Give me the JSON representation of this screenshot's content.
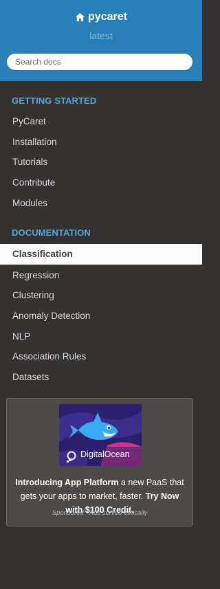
{
  "header": {
    "project_name": "pycaret",
    "version": "latest",
    "search_placeholder": "Search docs"
  },
  "sections": [
    {
      "caption": "GETTING STARTED",
      "items": [
        "PyCaret",
        "Installation",
        "Tutorials",
        "Contribute",
        "Modules"
      ]
    },
    {
      "caption": "DOCUMENTATION",
      "items": [
        "Classification",
        "Regression",
        "Clustering",
        "Anomaly Detection",
        "NLP",
        "Association Rules",
        "Datasets"
      ]
    }
  ],
  "active_item": "Classification",
  "ad": {
    "brand": "DigitalOcean",
    "headline_bold": "Introducing App Platform",
    "headline_rest": " a new PaaS that gets your apps to market, faster. ",
    "cta_bold": "Try Now with $100 Credit.",
    "sponsored_text": "Sponsored · Ads served ethically"
  },
  "colors": {
    "header_bg": "#2980b9",
    "sidebar_bg": "#343131",
    "caption": "#55a5d9",
    "active_bg": "#fcfcfc"
  },
  "icons": {
    "home": "home-icon"
  }
}
